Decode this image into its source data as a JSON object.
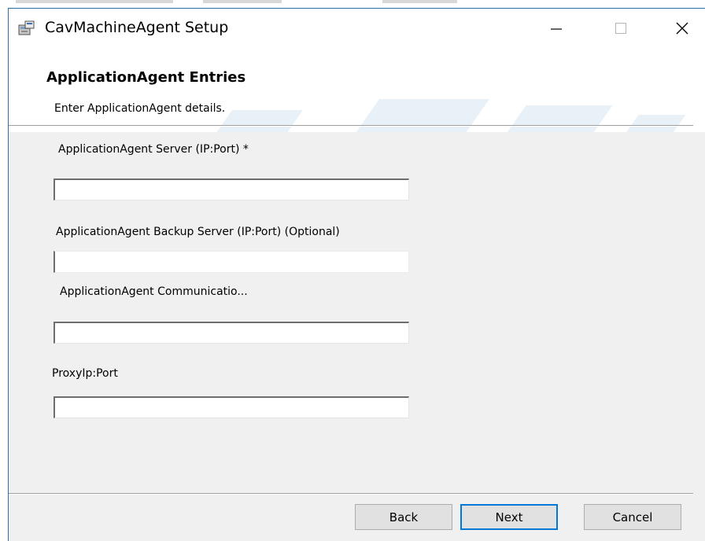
{
  "window": {
    "title": "CavMachineAgent Setup"
  },
  "banner": {
    "title": "ApplicationAgent Entries",
    "subtitle": "Enter ApplicationAgent details."
  },
  "form": {
    "fields": [
      {
        "label": "ApplicationAgent Server (IP:Port) *",
        "value": ""
      },
      {
        "label": "ApplicationAgent Backup Server (IP:Port) (Optional)",
        "value": ""
      },
      {
        "label": "ApplicationAgent Communicatio...",
        "value": ""
      },
      {
        "label": "ProxyIp:Port",
        "value": ""
      }
    ]
  },
  "buttons": {
    "back": "Back",
    "next": "Next",
    "cancel": "Cancel"
  },
  "icons": {
    "app": "installer-package-icon",
    "minimize": "minimize-icon",
    "maximize": "maximize-icon",
    "close": "close-icon"
  },
  "colors": {
    "window_border": "#2b6ea8",
    "default_button_border": "#0078d7",
    "dialog_background": "#f0f0f0"
  }
}
